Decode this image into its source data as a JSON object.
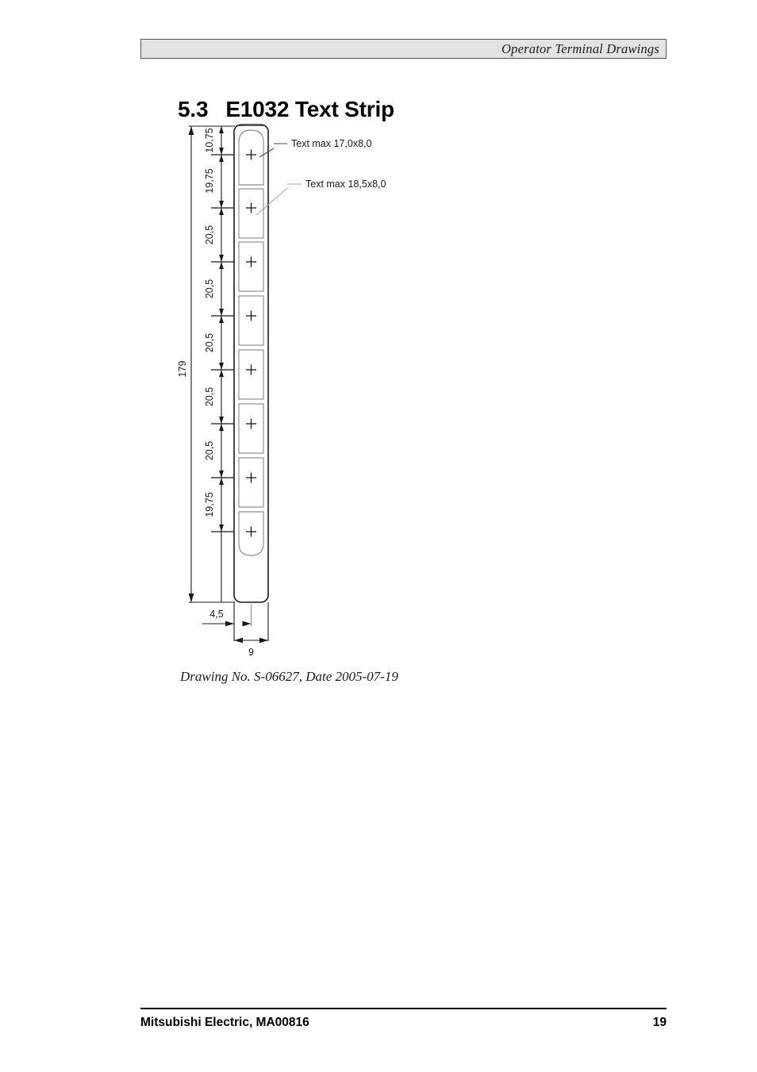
{
  "header": {
    "running_title": "Operator Terminal Drawings"
  },
  "heading": {
    "number": "5.3",
    "title": "E1032 Text Strip"
  },
  "drawing": {
    "caption": "Drawing No. S-06627, Date 2005-07-19",
    "annotations": [
      {
        "id": "anno-top-cell",
        "label": "Text max 17,0x8,0"
      },
      {
        "id": "anno-inner-cell",
        "label": "Text max 18,5x8,0"
      }
    ],
    "overall_dimension": "179",
    "vertical_dimensions": [
      "10,75",
      "19,75",
      "20,5",
      "20,5",
      "20,5",
      "20,5",
      "20,5",
      "19,75"
    ],
    "horizontal_dimensions": [
      "4,5",
      "9"
    ],
    "cell_marker": "+",
    "cell_count": 8,
    "colors": {
      "line": "#1a1a1a",
      "thin_line": "#8c8c8c",
      "fill": "#ffffff"
    }
  },
  "footer": {
    "company": "Mitsubishi Electric, MA00816",
    "page_number": "19"
  }
}
